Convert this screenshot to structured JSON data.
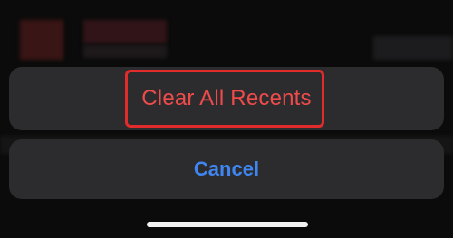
{
  "action_sheet": {
    "clear_all_label": "Clear All Recents",
    "cancel_label": "Cancel"
  },
  "colors": {
    "destructive": "#ef4b4b",
    "cancel": "#3f86f0",
    "highlight": "#e22b2b",
    "sheet_background": "#2c2c2e"
  }
}
